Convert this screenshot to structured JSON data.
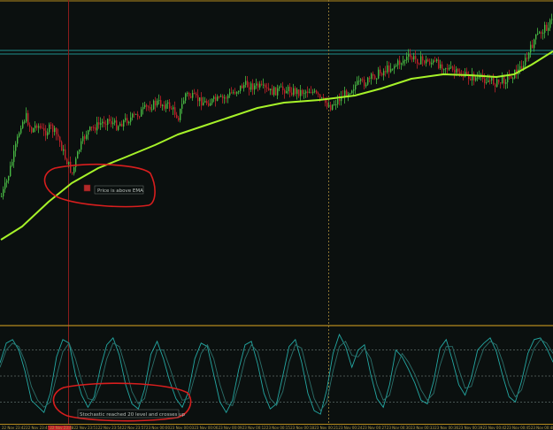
{
  "chart_data": [
    {
      "type": "candlestick",
      "panel": "price",
      "title": "",
      "xlabel": "",
      "ylabel": "",
      "grid": false,
      "colors": {
        "background": "#0b100f",
        "bull": "#48b843",
        "bear": "#c0222a",
        "ema": "#a6f229",
        "hline": "#1f8f8c",
        "frame": "#b58a1e"
      },
      "horizontal_levels": [
        57,
        61
      ],
      "vertical_markers": [
        {
          "bar": 38,
          "color": "#8c1b1b",
          "style": "solid"
        },
        {
          "bar": 185,
          "color": "#8a7232",
          "style": "dotted"
        }
      ],
      "ema_line": [
        {
          "bar": 0,
          "y": 271
        },
        {
          "bar": 12,
          "y": 256
        },
        {
          "bar": 27,
          "y": 228
        },
        {
          "bar": 40,
          "y": 207
        },
        {
          "bar": 55,
          "y": 190
        },
        {
          "bar": 70,
          "y": 178
        },
        {
          "bar": 87,
          "y": 164
        },
        {
          "bar": 100,
          "y": 152
        },
        {
          "bar": 115,
          "y": 142
        },
        {
          "bar": 130,
          "y": 132
        },
        {
          "bar": 145,
          "y": 122
        },
        {
          "bar": 160,
          "y": 116
        },
        {
          "bar": 180,
          "y": 113
        },
        {
          "bar": 200,
          "y": 108
        },
        {
          "bar": 215,
          "y": 100
        },
        {
          "bar": 232,
          "y": 89
        },
        {
          "bar": 250,
          "y": 84
        },
        {
          "bar": 265,
          "y": 85
        },
        {
          "bar": 280,
          "y": 87
        },
        {
          "bar": 290,
          "y": 84
        },
        {
          "bar": 300,
          "y": 73
        },
        {
          "bar": 312,
          "y": 58
        }
      ],
      "price_path": [
        {
          "bar": 0,
          "y": 222
        },
        {
          "bar": 3,
          "y": 205
        },
        {
          "bar": 7,
          "y": 175
        },
        {
          "bar": 11,
          "y": 140
        },
        {
          "bar": 14,
          "y": 132
        },
        {
          "bar": 17,
          "y": 148
        },
        {
          "bar": 20,
          "y": 140
        },
        {
          "bar": 24,
          "y": 150
        },
        {
          "bar": 28,
          "y": 144
        },
        {
          "bar": 32,
          "y": 155
        },
        {
          "bar": 36,
          "y": 178
        },
        {
          "bar": 40,
          "y": 196
        },
        {
          "bar": 44,
          "y": 168
        },
        {
          "bar": 48,
          "y": 150
        },
        {
          "bar": 54,
          "y": 142
        },
        {
          "bar": 60,
          "y": 135
        },
        {
          "bar": 65,
          "y": 142
        },
        {
          "bar": 70,
          "y": 136
        },
        {
          "bar": 75,
          "y": 132
        },
        {
          "bar": 82,
          "y": 122
        },
        {
          "bar": 88,
          "y": 116
        },
        {
          "bar": 95,
          "y": 120
        },
        {
          "bar": 100,
          "y": 132
        },
        {
          "bar": 104,
          "y": 106
        },
        {
          "bar": 108,
          "y": 110
        },
        {
          "bar": 115,
          "y": 116
        },
        {
          "bar": 125,
          "y": 112
        },
        {
          "bar": 132,
          "y": 103
        },
        {
          "bar": 137,
          "y": 96
        },
        {
          "bar": 145,
          "y": 98
        },
        {
          "bar": 152,
          "y": 104
        },
        {
          "bar": 160,
          "y": 101
        },
        {
          "bar": 168,
          "y": 104
        },
        {
          "bar": 175,
          "y": 102
        },
        {
          "bar": 180,
          "y": 112
        },
        {
          "bar": 186,
          "y": 120
        },
        {
          "bar": 192,
          "y": 110
        },
        {
          "bar": 200,
          "y": 96
        },
        {
          "bar": 206,
          "y": 93
        },
        {
          "bar": 212,
          "y": 84
        },
        {
          "bar": 218,
          "y": 78
        },
        {
          "bar": 224,
          "y": 72
        },
        {
          "bar": 230,
          "y": 65
        },
        {
          "bar": 236,
          "y": 68
        },
        {
          "bar": 242,
          "y": 70
        },
        {
          "bar": 250,
          "y": 74
        },
        {
          "bar": 256,
          "y": 82
        },
        {
          "bar": 262,
          "y": 86
        },
        {
          "bar": 268,
          "y": 88
        },
        {
          "bar": 274,
          "y": 90
        },
        {
          "bar": 280,
          "y": 94
        },
        {
          "bar": 286,
          "y": 88
        },
        {
          "bar": 292,
          "y": 80
        },
        {
          "bar": 297,
          "y": 66
        },
        {
          "bar": 301,
          "y": 45
        },
        {
          "bar": 306,
          "y": 34
        },
        {
          "bar": 310,
          "y": 26
        },
        {
          "bar": 312,
          "y": 22
        }
      ],
      "annotations": [
        {
          "text": "Price is above EMA",
          "bar": 55
        }
      ]
    },
    {
      "type": "line",
      "panel": "stochastic",
      "title": "",
      "ylabel": "",
      "levels": [
        20,
        50,
        80
      ],
      "series": [
        {
          "color": "#23a8a3",
          "values": [
            65,
            88,
            92,
            80,
            55,
            22,
            15,
            8,
            30,
            72,
            92,
            88,
            52,
            28,
            14,
            26,
            60,
            86,
            94,
            74,
            40,
            18,
            12,
            35,
            75,
            90,
            70,
            44,
            24,
            14,
            32,
            70,
            88,
            84,
            52,
            20,
            8,
            22,
            58,
            86,
            90,
            64,
            30,
            12,
            18,
            50,
            84,
            92,
            66,
            30,
            10,
            6,
            34,
            76,
            98,
            84,
            60,
            80,
            86,
            52,
            24,
            14,
            40,
            80,
            72,
            58,
            42,
            22,
            18,
            44,
            82,
            92,
            68,
            40,
            28,
            48,
            80,
            88,
            94,
            78,
            50,
            26,
            20,
            44,
            76,
            92,
            94,
            82,
            66
          ]
        },
        {
          "color": "#2b6f6a",
          "values": [
            60,
            80,
            88,
            84,
            66,
            38,
            22,
            14,
            20,
            50,
            78,
            88,
            70,
            44,
            24,
            22,
            40,
            70,
            88,
            84,
            60,
            32,
            18,
            24,
            55,
            80,
            80,
            60,
            38,
            22,
            24,
            50,
            76,
            86,
            70,
            40,
            18,
            16,
            40,
            70,
            86,
            78,
            50,
            24,
            16,
            32,
            66,
            86,
            82,
            52,
            24,
            10,
            20,
            56,
            84,
            90,
            74,
            72,
            82,
            70,
            40,
            22,
            28,
            58,
            76,
            66,
            52,
            34,
            22,
            30,
            62,
            84,
            84,
            58,
            36,
            38,
            62,
            82,
            90,
            86,
            66,
            40,
            26,
            34,
            60,
            82,
            92,
            88,
            76
          ]
        }
      ],
      "annotations": [
        {
          "text": "Stochastic reached 20 level and crosses up"
        }
      ]
    }
  ],
  "time_axis": {
    "labels": [
      "22 Nov 23:42",
      "22 Nov 23:45",
      "22 Nov 23:48",
      "22 Nov 23:51",
      "22 Nov 23:54",
      "22 Nov 23:57",
      "23 Nov 00:00",
      "23 Nov 00:03",
      "23 Nov 00:06",
      "23 Nov 00:09",
      "23 Nov 00:12",
      "23 Nov 00:15",
      "23 Nov 00:18",
      "23 Nov 00:21",
      "23 Nov 00:24",
      "23 Nov 00:27",
      "23 Nov 00:30",
      "23 Nov 00:33",
      "23 Nov 00:36",
      "23 Nov 00:39",
      "23 Nov 00:42",
      "23 Nov 00:45",
      "23 Nov 00:48"
    ],
    "highlight_index": 2,
    "highlight_color": "#c0222a"
  },
  "markup_color": "#d81e1e"
}
